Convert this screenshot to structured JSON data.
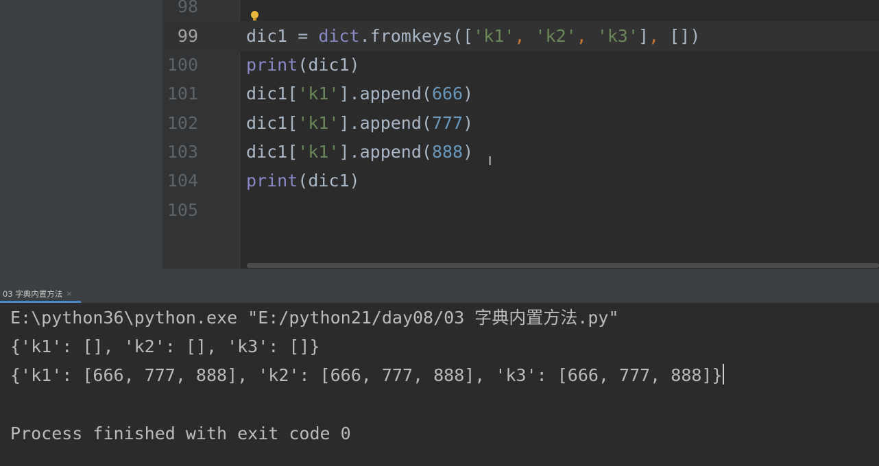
{
  "gutter": {
    "line_numbers": [
      "98",
      "99",
      "100",
      "101",
      "102",
      "103",
      "104",
      "105"
    ],
    "current_line": "99"
  },
  "code": {
    "line99": {
      "var": "dic1",
      "eq": " = ",
      "builtin": "dict",
      "method": ".fromkeys([",
      "s1": "'k1'",
      "c1": ", ",
      "s2": "'k2'",
      "c2": ", ",
      "s3": "'k3'",
      "close": "]",
      "c3": ", ",
      "tail": "[])"
    },
    "line100": {
      "builtin": "print",
      "args": "(dic1)"
    },
    "line101": {
      "pre": "dic1[",
      "str": "'k1'",
      "mid": "].append(",
      "num": "666",
      "post": ")"
    },
    "line102": {
      "pre": "dic1[",
      "str": "'k1'",
      "mid": "].append(",
      "num": "777",
      "post": ")"
    },
    "line103": {
      "pre": "dic1[",
      "str": "'k1'",
      "mid": "].append(",
      "num": "888",
      "post": ")"
    },
    "line104": {
      "builtin": "print",
      "args": "(dic1)"
    }
  },
  "run_panel": {
    "tab_label": "03 字典内置方法",
    "tab_close": "×"
  },
  "console": {
    "lines": [
      "E:\\python36\\python.exe \"E:/python21/day08/03 字典内置方法.py\"",
      "{'k1': [], 'k2': [], 'k3': []}",
      "{'k1': [666, 777, 888], 'k2': [666, 777, 888], 'k3': [666, 777, 888]}",
      "",
      "Process finished with exit code 0"
    ]
  },
  "icons": {
    "intention": "lightbulb-icon",
    "mouse": "text-cursor-icon",
    "run_tab": "python-run-icon"
  },
  "colors": {
    "background": "#2b2b2b",
    "builtin": "#8888c6",
    "string": "#6a8759",
    "number": "#6897bb",
    "comma": "#cc7832",
    "tab_accent": "#4a88c7"
  }
}
